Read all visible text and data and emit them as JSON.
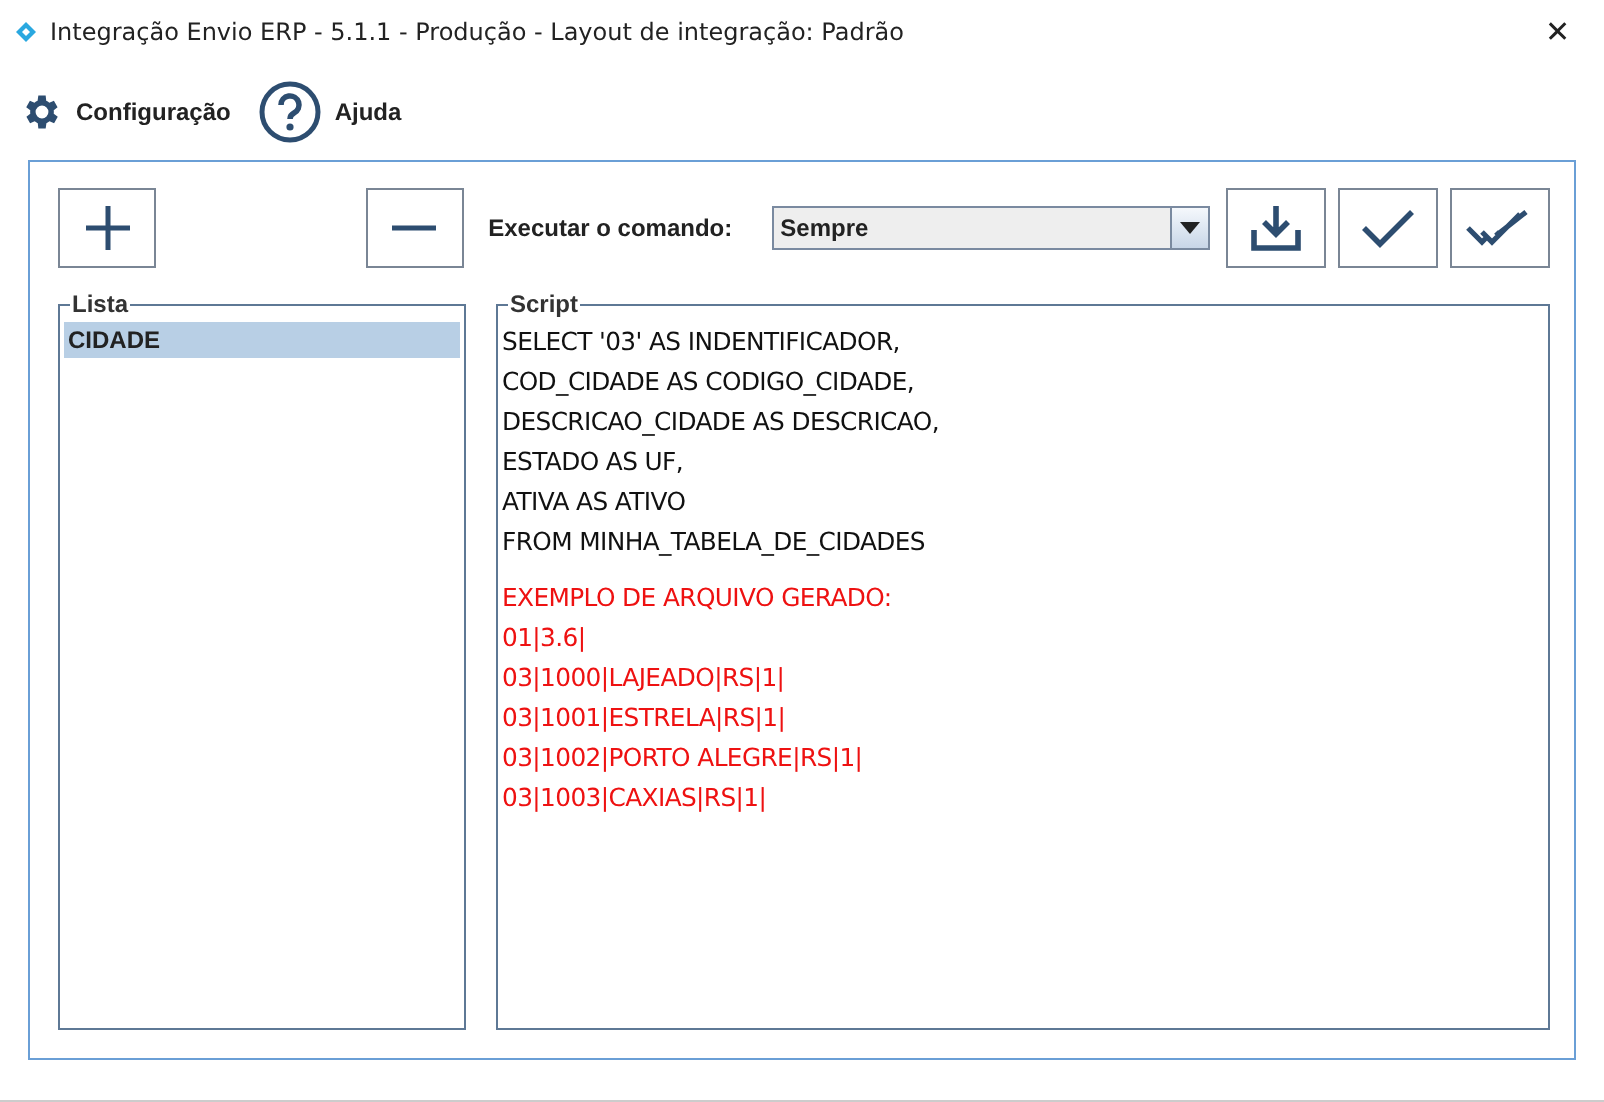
{
  "window": {
    "title": "Integração Envio ERP - 5.1.1 - Produção - Layout de integração: Padrão",
    "close": "✕"
  },
  "menu": [
    {
      "kind": "gear",
      "label": "Configuração"
    },
    {
      "kind": "help",
      "label": "Ajuda"
    }
  ],
  "command": {
    "label": "Executar o comando:",
    "value": "Sempre"
  },
  "list": {
    "title": "Lista",
    "items": [
      {
        "label": "CIDADE",
        "selected": true
      }
    ]
  },
  "script": {
    "title": "Script",
    "blocks": [
      {
        "kind": "sql",
        "lines": [
          "SELECT '03' AS INDENTIFICADOR,",
          "COD_CIDADE AS CODIGO_CIDADE,",
          "DESCRICAO_CIDADE AS DESCRICAO,",
          "ESTADO AS UF,",
          "ATIVA AS ATIVO",
          "FROM MINHA_TABELA_DE_CIDADES"
        ]
      },
      {
        "kind": "example",
        "lines": [
          "EXEMPLO DE ARQUIVO GERADO:",
          "01|3.6|",
          "03|1000|LAJEADO|RS|1|",
          "03|1001|ESTRELA|RS|1|",
          "03|1002|PORTO ALEGRE|RS|1|",
          "03|1003|CAXIAS|RS|1|"
        ]
      }
    ]
  }
}
